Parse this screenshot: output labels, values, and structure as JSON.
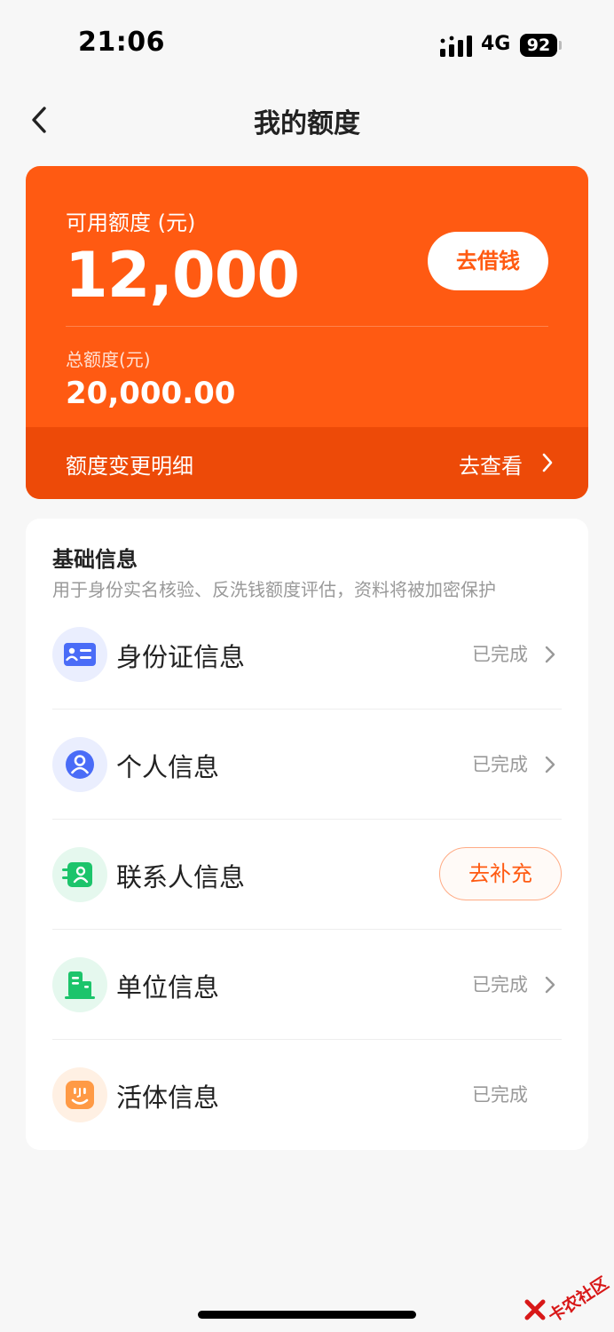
{
  "status_bar": {
    "time": "21:06",
    "network": "4G",
    "battery": "92"
  },
  "nav": {
    "title": "我的额度",
    "back_icon": "chevron-left-icon"
  },
  "credit": {
    "available_label": "可用额度 (元)",
    "available_amount": "12,000",
    "borrow_button": "去借钱",
    "total_label": "总额度(元)",
    "total_amount": "20,000.00",
    "change_detail_label": "额度变更明细",
    "view_link": "去查看"
  },
  "basic_info": {
    "title": "基础信息",
    "subtitle": "用于身份实名核验、反洗钱额度评估，资料将被加密保护",
    "items": [
      {
        "label": "身份证信息",
        "status": "已完成",
        "icon": "id-card-icon",
        "icon_color": "#4a6cf7",
        "icon_bg": "#eaeefe",
        "has_chevron": true
      },
      {
        "label": "个人信息",
        "status": "已完成",
        "icon": "person-icon",
        "icon_color": "#4a6cf7",
        "icon_bg": "#eaeefe",
        "has_chevron": true
      },
      {
        "label": "联系人信息",
        "action": "去补充",
        "icon": "contact-icon",
        "icon_color": "#1cc46b",
        "icon_bg": "#e5f8ee"
      },
      {
        "label": "单位信息",
        "status": "已完成",
        "icon": "building-icon",
        "icon_color": "#1cc46b",
        "icon_bg": "#e5f8ee",
        "has_chevron": true
      },
      {
        "label": "活体信息",
        "status": "已完成",
        "icon": "face-icon",
        "icon_color": "#ff9a45",
        "icon_bg": "#fff0e3",
        "has_chevron": false
      }
    ]
  },
  "watermark": {
    "text": "卡农社区"
  },
  "colors": {
    "brand": "#ff5a12",
    "brand_dark": "#ed4a08",
    "background": "#f7f7f7"
  }
}
